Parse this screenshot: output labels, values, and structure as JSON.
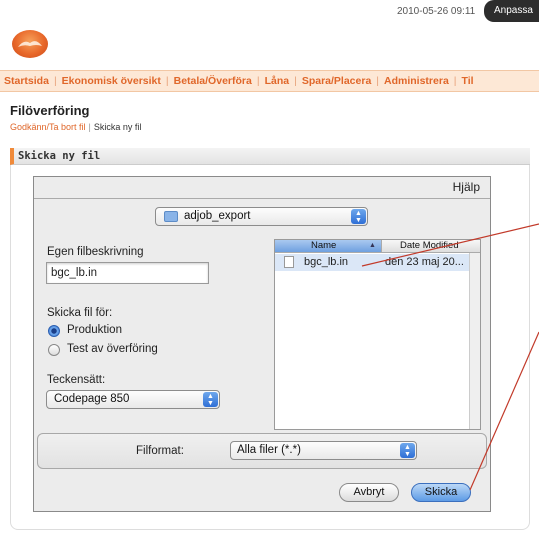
{
  "header": {
    "timestamp": "2010-05-26 09:11",
    "customize_button": "Anpassa"
  },
  "main_nav": {
    "items": [
      "Startsida",
      "Ekonomisk översikt",
      "Betala/Överföra",
      "Låna",
      "Spara/Placera",
      "Administrera",
      "Til"
    ]
  },
  "page": {
    "title": "Filöverföring",
    "sub_nav": {
      "link": "Godkänn/Ta bort fil",
      "current": "Skicka ny fil"
    }
  },
  "section": {
    "title": "Skicka ny fil"
  },
  "dialog": {
    "help_label": "Hjälp",
    "folder_popup": "adjob_export",
    "description_label": "Egen filbeskrivning",
    "description_value": "bgc_lb.in",
    "send_for_label": "Skicka fil för:",
    "radio_production": "Produktion",
    "radio_test": "Test av överföring",
    "charset_label": "Teckensätt:",
    "charset_value": "Codepage 850",
    "browser": {
      "col_name": "Name",
      "col_date": "Date Modified",
      "rows": [
        {
          "name": "bgc_lb.in",
          "date": "den 23 maj 20..."
        }
      ]
    },
    "format_label": "Filformat:",
    "format_value": "Alla filer (*.*)",
    "cancel_button": "Avbryt",
    "send_button": "Skicka"
  },
  "colors": {
    "accent_orange": "#e0672a",
    "nav_background": "#fde8d6",
    "annotation_line": "#c23a2a",
    "selection_blue": "#dbe7f7"
  }
}
